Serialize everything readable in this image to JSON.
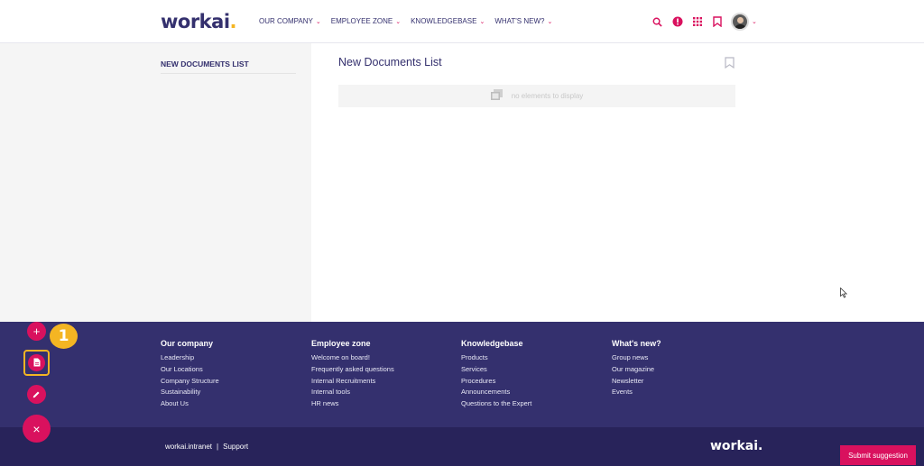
{
  "header": {
    "logo_text": "workai",
    "logo_dot": ".",
    "nav": [
      {
        "label": "OUR COMPANY"
      },
      {
        "label": "EMPLOYEE ZONE"
      },
      {
        "label": "KNOWLEDGEBASE"
      },
      {
        "label": "WHAT'S NEW?"
      }
    ],
    "icons": [
      "search-icon",
      "alert-icon",
      "apps-grid-icon",
      "bookmark-icon",
      "user-avatar"
    ]
  },
  "sidebar": {
    "title": "NEW DOCUMENTS LIST"
  },
  "main": {
    "title": "New Documents List",
    "empty_text": "no elements to display"
  },
  "footer": {
    "columns": [
      {
        "title": "Our company",
        "links": [
          "Leadership",
          "Our Locations",
          "Company Structure",
          "Sustainability",
          "About Us"
        ]
      },
      {
        "title": "Employee zone",
        "links": [
          "Welcome on board!",
          "Frequently asked questions",
          "Internal Recruitments",
          "Internal tools",
          "HR news"
        ]
      },
      {
        "title": "Knowledgebase",
        "links": [
          "Products",
          "Services",
          "Procedures",
          "Announcements",
          "Questions to the Expert"
        ]
      },
      {
        "title": "What's new?",
        "links": [
          "Group news",
          "Our magazine",
          "Newsletter",
          "Events"
        ]
      }
    ],
    "bottom_link_1": "workai.intranet",
    "bottom_sep": "|",
    "bottom_link_2": "Support",
    "bottom_logo": "workai."
  },
  "submit_label": "Submit suggestion",
  "fab": {
    "add": "+",
    "close": "×"
  },
  "step_badge": "1",
  "colors": {
    "brand": "#34306e",
    "accent": "#d9115e",
    "highlight": "#f4b523"
  }
}
